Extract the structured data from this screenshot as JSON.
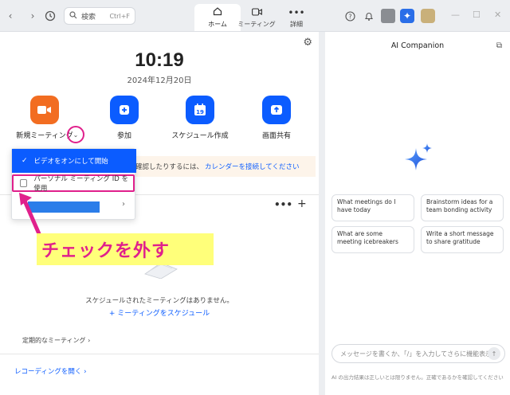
{
  "titlebar": {
    "search_label": "検索",
    "search_shortcut": "Ctrl+F",
    "tabs": [
      {
        "label": "ホーム",
        "icon": "home-icon"
      },
      {
        "label": "ミーティング",
        "icon": "video-icon"
      },
      {
        "label": "詳細",
        "icon": "more-icon"
      }
    ]
  },
  "home": {
    "time": "10:19",
    "date": "2024年12月20日",
    "actions": [
      {
        "label": "新規ミーティング",
        "icon": "video-camera-icon",
        "color": "#f26d21"
      },
      {
        "label": "参加",
        "icon": "plus-icon",
        "color": "#0b5cff"
      },
      {
        "label": "スケジュール作成",
        "icon": "calendar-icon",
        "color": "#0b5cff",
        "glyph": "19"
      },
      {
        "label": "画面共有",
        "icon": "share-screen-icon",
        "color": "#0b5cff"
      }
    ],
    "notice_text": "確認したりするには、",
    "notice_link": "カレンダーを接続してください",
    "empty_text": "スケジュールされたミーティングはありません。",
    "schedule_link": "ミーティングをスケジュール",
    "recurring": "定期的なミーティング",
    "recording": "レコーディングを開く"
  },
  "menu": {
    "item1": "ビデオをオンにして開始",
    "item2": "パーソナル ミーティング ID を使用"
  },
  "annotation": {
    "text": "チェックを外す",
    "color": "#e0208c"
  },
  "companion": {
    "title": "AI Companion",
    "suggestions": [
      "What meetings do I have today",
      "Brainstorm ideas for a team bonding activity",
      "What are some meeting icebreakers",
      "Write a short message to share gratitude"
    ],
    "input_placeholder": "メッセージを書くか、「/」を入力してさらに機能表示",
    "footer": "AI の出力結果は正しいとは限りません。正確であるかを確認してください"
  }
}
